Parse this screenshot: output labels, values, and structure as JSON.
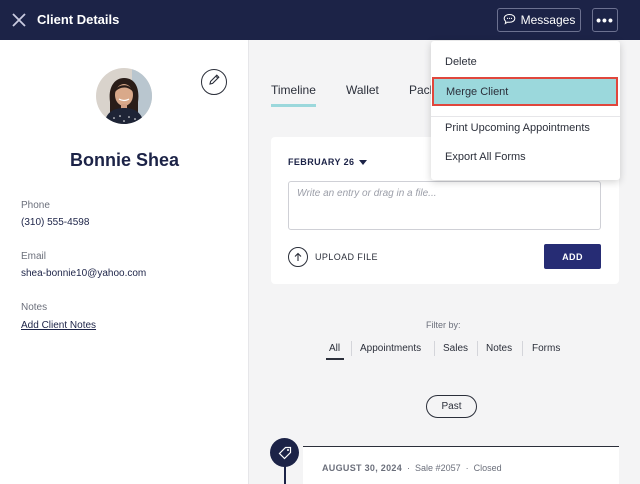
{
  "header": {
    "title": "Client Details",
    "messages_label": "Messages",
    "more_label": "•••"
  },
  "client": {
    "name": "Bonnie Shea",
    "phone_label": "Phone",
    "phone": "(310) 555-4598",
    "email_label": "Email",
    "email": "shea-bonnie10@yahoo.com",
    "notes_label": "Notes",
    "notes_link": "Add Client Notes"
  },
  "tabs": [
    {
      "label": "Timeline",
      "active": true
    },
    {
      "label": "Wallet",
      "active": false
    },
    {
      "label": "Pack",
      "active": false
    }
  ],
  "entry_card": {
    "date": "FEBRUARY 26",
    "placeholder": "Write an entry or drag in a file...",
    "upload_label": "UPLOAD FILE",
    "add_label": "ADD"
  },
  "filter": {
    "label": "Filter by:",
    "options": [
      "All",
      "Appointments",
      "Sales",
      "Notes",
      "Forms"
    ],
    "selected": "All"
  },
  "past_label": "Past",
  "timeline_entry": {
    "date": "AUGUST 30, 2024",
    "sale": "Sale #2057",
    "status": "Closed",
    "separator": "·"
  },
  "menu": {
    "items": [
      "Delete",
      "Merge Client",
      "Print Upcoming Appointments",
      "Export All Forms"
    ],
    "highlighted": "Merge Client"
  },
  "colors": {
    "header_bg": "#1c2347",
    "accent": "#9bd8dc",
    "primary_button": "#262c74",
    "highlight_border": "#e0463c"
  },
  "icons": [
    "close-icon",
    "chat-bubble-icon",
    "pencil-icon",
    "caret-down-icon",
    "upload-arrow-icon",
    "tag-icon"
  ]
}
